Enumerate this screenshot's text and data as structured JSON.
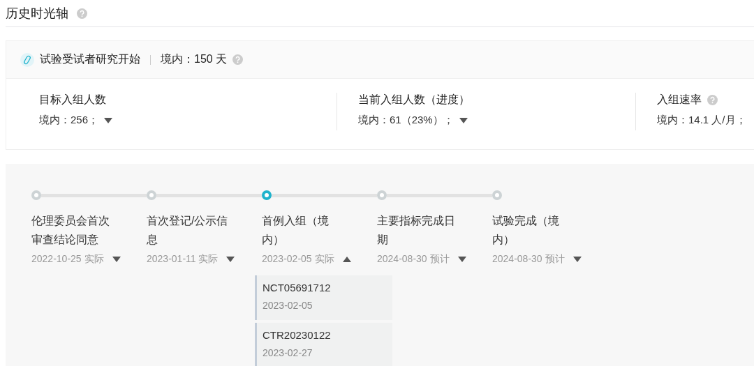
{
  "section": {
    "title": "历史时光轴",
    "help": true
  },
  "summary": {
    "title": "试验受试者研究开始",
    "value": "境内：150 天",
    "help": true
  },
  "stats": [
    {
      "label": "目标入组人数",
      "value": "境内：256；",
      "help": false,
      "dropdown": true
    },
    {
      "label": "当前入组人数（进度）",
      "value": "境内：61（23%）；",
      "help": false,
      "dropdown": true
    },
    {
      "label": "入组速率",
      "value": "境内：14.1 人/月；",
      "help": true,
      "dropdown": false
    }
  ],
  "timeline": [
    {
      "title": "伦理委员会首次审查结论同意",
      "date": "2022-10-25 实际",
      "selected": false,
      "expanded": false
    },
    {
      "title": "首次登记/公示信息",
      "date": "2023-01-11 实际",
      "selected": false,
      "expanded": false
    },
    {
      "title": "首例入组（境内）",
      "date": "2023-02-05 实际",
      "selected": true,
      "expanded": true,
      "records": [
        {
          "id": "NCT05691712",
          "date": "2023-02-05"
        },
        {
          "id": "CTR20230122",
          "date": "2023-02-27"
        }
      ]
    },
    {
      "title": "主要指标完成日期",
      "date": "2024-08-30 预计",
      "selected": false,
      "expanded": false
    },
    {
      "title": "试验完成（境内）",
      "date": "2024-08-30 预计",
      "selected": false,
      "expanded": false
    }
  ]
}
